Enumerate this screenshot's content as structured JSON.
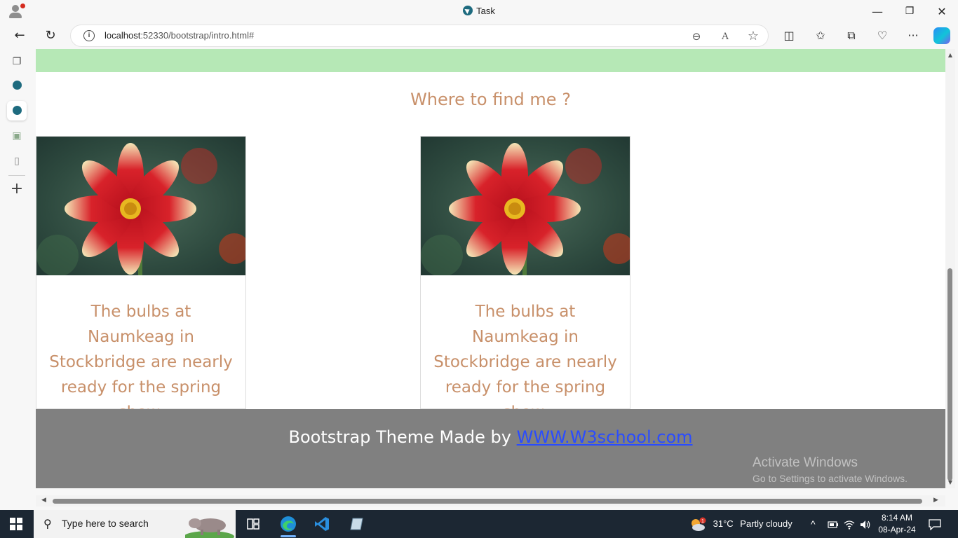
{
  "window": {
    "title": "Task",
    "minimize_glyph": "—",
    "restore_glyph": "❐",
    "close_glyph": "✕"
  },
  "toolbar": {
    "url_host": "localhost",
    "url_rest": ":52330/bootstrap/intro.html#",
    "back_glyph": "←",
    "refresh_glyph": "↻",
    "info_glyph": "i",
    "zoom_glyph": "⊖",
    "read_aloud_glyph": "A",
    "favorite_glyph": "☆",
    "split_glyph": "◫",
    "favorites_glyph": "✩",
    "collections_glyph": "⧉",
    "performance_glyph": "♡",
    "more_glyph": "···"
  },
  "sidebar": {
    "tabs_glyph": "❐",
    "contacts_glyph": "▣",
    "page_glyph": "▯",
    "add_glyph": "+"
  },
  "page": {
    "heading": "Where to find me ?",
    "cards": [
      {
        "caption": "The bulbs at Naumkeag in Stockbridge are nearly ready for the spring show."
      },
      {
        "caption": "The bulbs at Naumkeag in Stockbridge are nearly ready for the spring show."
      }
    ],
    "footer_prefix": "Bootstrap Theme Made by ",
    "footer_link": "WWW.W3school.com"
  },
  "watermark": {
    "line1": "Activate Windows",
    "line2": "Go to Settings to activate Windows."
  },
  "taskbar": {
    "search_placeholder": "Type here to search",
    "weather_temp": "31°C",
    "weather_desc": "Partly cloudy",
    "weather_badge": "1",
    "time": "8:14 AM",
    "date": "08-Apr-24",
    "chevron_glyph": "^",
    "notification_glyph": "▭"
  },
  "colors": {
    "heading": "#c8906a",
    "green_band": "#b6e8b6",
    "footer_bg": "#808080",
    "link": "#2a4cff",
    "taskbar": "#1c2733"
  }
}
